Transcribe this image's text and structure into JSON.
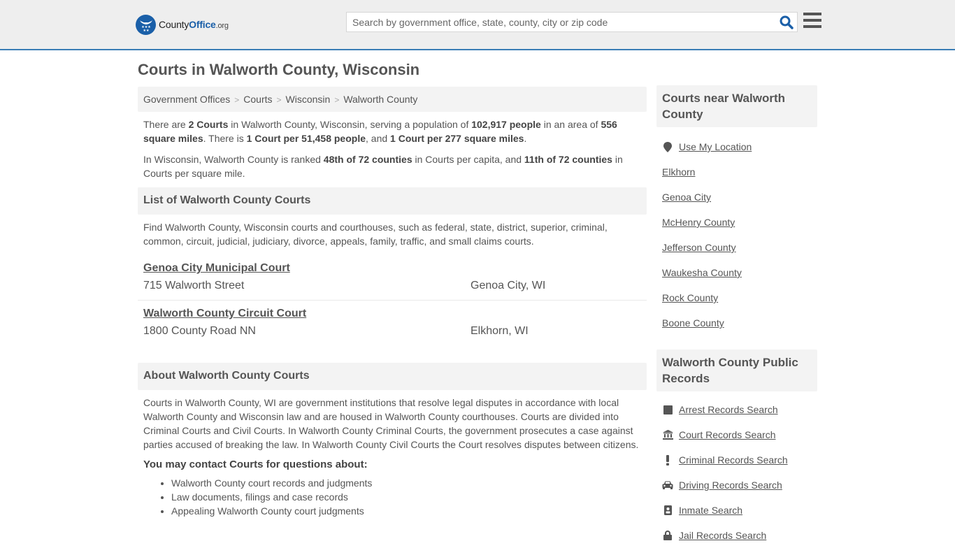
{
  "header": {
    "logo": {
      "text_main": "County",
      "text_accent": "Office",
      "text_suffix": ".org"
    },
    "search": {
      "placeholder": "Search by government office, state, county, city or zip code",
      "value": ""
    },
    "icons": {
      "search": "search-icon",
      "menu": "hamburger-menu-icon"
    }
  },
  "page": {
    "title": "Courts in Walworth County, Wisconsin"
  },
  "breadcrumb": [
    {
      "label": "Government Offices"
    },
    {
      "label": "Courts"
    },
    {
      "label": "Wisconsin"
    },
    {
      "label": "Walworth County"
    }
  ],
  "intro": {
    "p1": {
      "t1": "There are ",
      "b1": "2 Courts",
      "t2": " in Walworth County, Wisconsin, serving a population of ",
      "b2": "102,917 people",
      "t3": " in an area of ",
      "b3": "556 square miles",
      "t4": ". There is ",
      "b4": "1 Court per 51,458 people",
      "t5": ", and ",
      "b5": "1 Court per 277 square miles",
      "t6": "."
    },
    "p2": {
      "t1": "In Wisconsin, Walworth County is ranked ",
      "b1": "48th of 72 counties",
      "t2": " in Courts per capita, and ",
      "b2": "11th of 72 counties",
      "t3": " in Courts per square mile."
    }
  },
  "list_section": {
    "heading": "List of Walworth County Courts",
    "description": "Find Walworth County, Wisconsin courts and courthouses, such as federal, state, district, superior, criminal, common, circuit, judicial, judiciary, divorce, appeals, family, traffic, and small claims courts.",
    "courts": [
      {
        "name": "Genoa City Municipal Court",
        "address": "715 Walworth Street",
        "city": "Genoa City, WI"
      },
      {
        "name": "Walworth County Circuit Court",
        "address": "1800 County Road NN",
        "city": "Elkhorn, WI"
      }
    ]
  },
  "about_section": {
    "heading": "About Walworth County Courts",
    "body": "Courts in Walworth County, WI are government institutions that resolve legal disputes in accordance with local Walworth County and Wisconsin law and are housed in Walworth County courthouses. Courts are divided into Criminal Courts and Civil Courts. In Walworth County Criminal Courts, the government prosecutes a case against parties accused of breaking the law. In Walworth County Civil Courts the Court resolves disputes between citizens.",
    "contact_heading": "You may contact Courts for questions about:",
    "contact_items": [
      "Walworth County court records and judgments",
      "Law documents, filings and case records",
      "Appealing Walworth County court judgments"
    ]
  },
  "sidebar": {
    "nearby": {
      "heading": "Courts near Walworth County",
      "use_location": {
        "label": "Use My Location",
        "icon": "map-marker-icon"
      },
      "links": [
        "Elkhorn",
        "Genoa City",
        "McHenry County",
        "Jefferson County",
        "Waukesha County",
        "Rock County",
        "Boone County"
      ]
    },
    "records": {
      "heading": "Walworth County Public Records",
      "links": [
        {
          "label": "Arrest Records Search",
          "icon": "square-icon"
        },
        {
          "label": "Court Records Search",
          "icon": "courthouse-icon"
        },
        {
          "label": "Criminal Records Search",
          "icon": "exclamation-icon"
        },
        {
          "label": "Driving Records Search",
          "icon": "car-icon"
        },
        {
          "label": "Inmate Search",
          "icon": "id-badge-icon"
        },
        {
          "label": "Jail Records Search",
          "icon": "lock-icon"
        }
      ]
    }
  },
  "colors": {
    "brand": "#1a5fa8",
    "header_border": "#3a7db5",
    "header_bg": "#eeeeee",
    "panel_bg": "#f3f3f3",
    "text": "#555555"
  }
}
